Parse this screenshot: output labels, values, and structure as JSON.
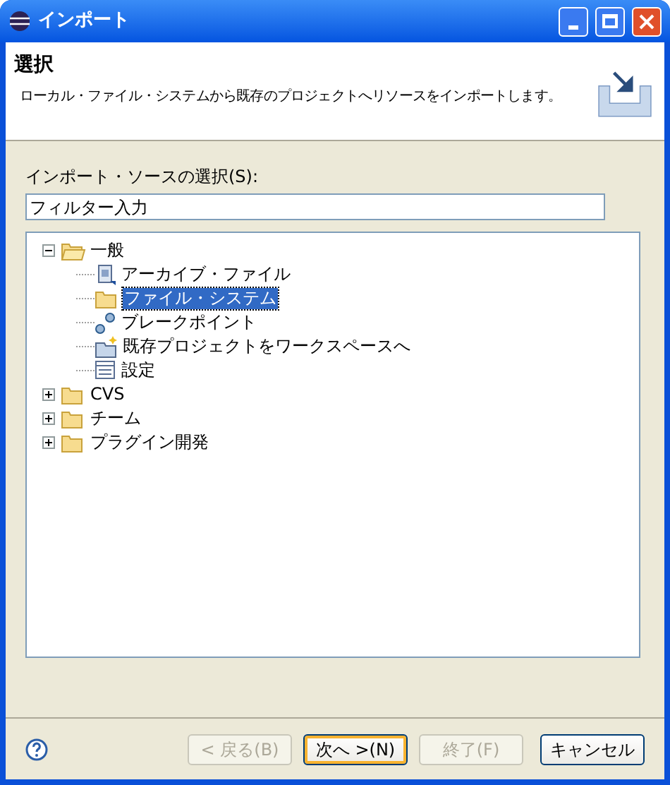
{
  "window": {
    "title": "インポート"
  },
  "header": {
    "title": "選択",
    "description": "ローカル・ファイル・システムから既存のプロジェクトへリソースをインポートします。"
  },
  "source_label": "インポート・ソースの選択(S):",
  "filter": {
    "placeholder": "フィルター入力"
  },
  "tree": [
    {
      "label": "一般",
      "kind": "folder",
      "expanded": true,
      "selected": false,
      "children": [
        {
          "label": "アーカイブ・ファイル",
          "kind": "archive",
          "selected": false
        },
        {
          "label": "ファイル・システム",
          "kind": "folder",
          "selected": true
        },
        {
          "label": "ブレークポイント",
          "kind": "breakpoint",
          "selected": false
        },
        {
          "label": "既存プロジェクトをワークスペースへ",
          "kind": "project",
          "selected": false
        },
        {
          "label": "設定",
          "kind": "settings",
          "selected": false
        }
      ]
    },
    {
      "label": "CVS",
      "kind": "folder",
      "expanded": false,
      "selected": false
    },
    {
      "label": "チーム",
      "kind": "folder",
      "expanded": false,
      "selected": false
    },
    {
      "label": "プラグイン開発",
      "kind": "folder",
      "expanded": false,
      "selected": false
    }
  ],
  "buttons": [
    {
      "label": "< 戻る(B)",
      "disabled": true,
      "default": false
    },
    {
      "label": "次へ >(N)",
      "disabled": false,
      "default": true
    },
    {
      "label": "終了(F)",
      "disabled": true,
      "default": false
    },
    {
      "label": "キャンセル",
      "disabled": false,
      "default": false
    }
  ]
}
